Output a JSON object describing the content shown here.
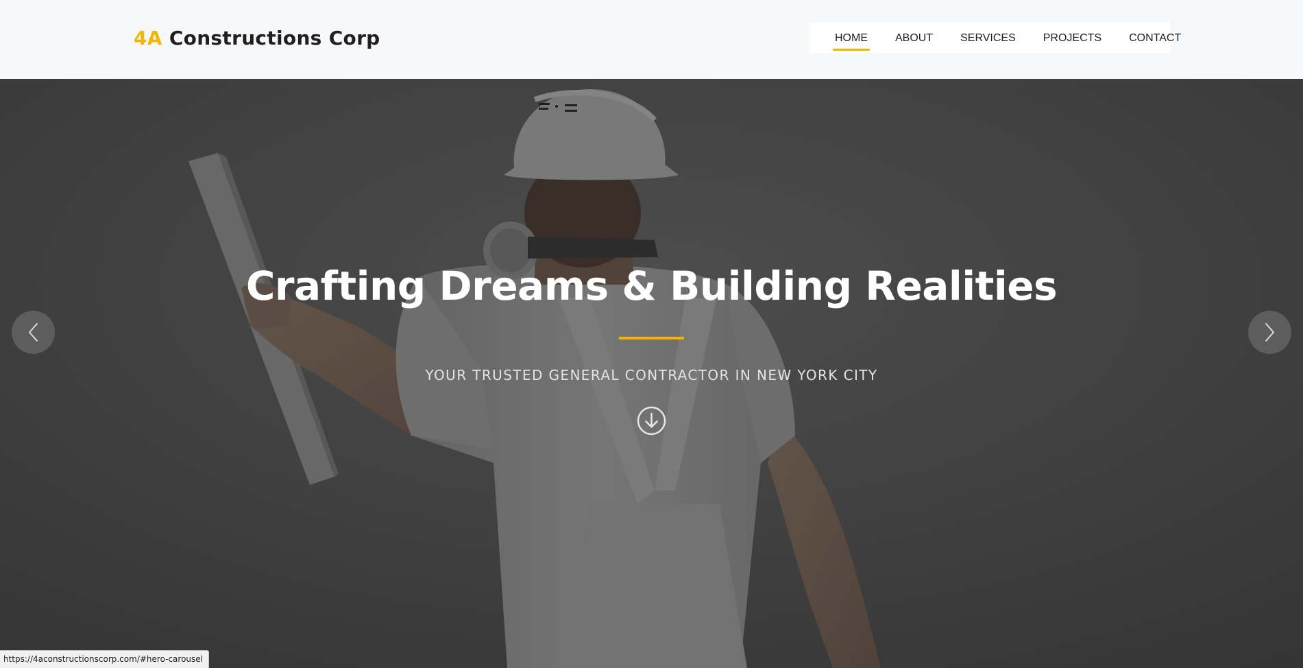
{
  "header": {
    "logo_accent": "4A",
    "logo_rest": " Constructions Corp",
    "accent_color": "#f2b705",
    "nav": [
      {
        "label": "HOME",
        "active": true
      },
      {
        "label": "ABOUT",
        "active": false
      },
      {
        "label": "SERVICES",
        "active": false
      },
      {
        "label": "PROJECTS",
        "active": false
      },
      {
        "label": "CONTACT",
        "active": false
      }
    ]
  },
  "hero": {
    "title": "Crafting Dreams & Building Realities",
    "subtitle": "YOUR TRUSTED GENERAL CONTRACTOR IN NEW YORK CITY",
    "scroll_icon": "arrow-down-circle-icon",
    "prev_icon": "chevron-left-icon",
    "next_icon": "chevron-right-icon"
  },
  "status_bar": {
    "url": "https://4aconstructionscorp.com/#hero-carousel"
  }
}
